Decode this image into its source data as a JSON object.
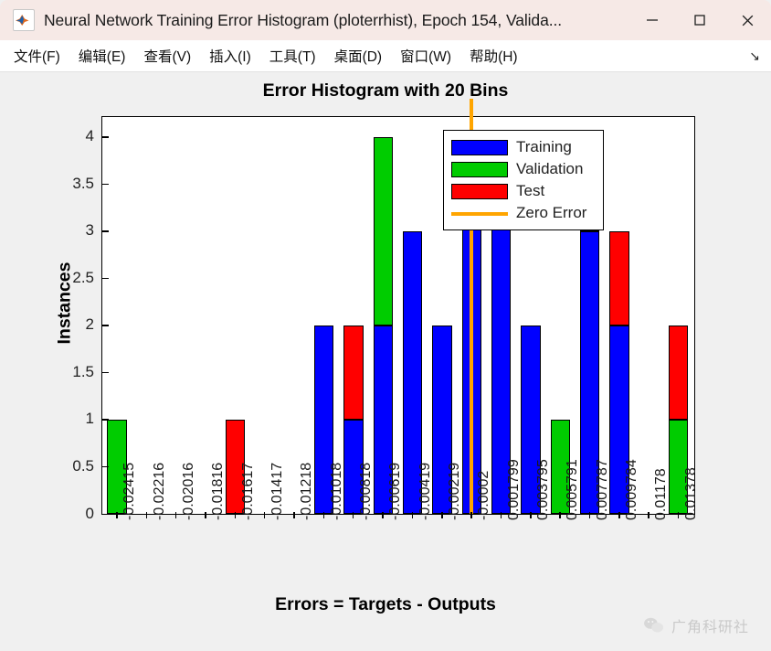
{
  "window": {
    "title": "Neural Network Training Error Histogram (ploterrhist), Epoch 154, Valida...",
    "app_icon": "matlab-icon",
    "minimize_label": "─",
    "maximize_label": "□",
    "close_label": "✕"
  },
  "menubar": {
    "items": [
      {
        "label": "文件(F)",
        "name": "menu-file"
      },
      {
        "label": "编辑(E)",
        "name": "menu-edit"
      },
      {
        "label": "查看(V)",
        "name": "menu-view"
      },
      {
        "label": "插入(I)",
        "name": "menu-insert"
      },
      {
        "label": "工具(T)",
        "name": "menu-tools"
      },
      {
        "label": "桌面(D)",
        "name": "menu-desktop"
      },
      {
        "label": "窗口(W)",
        "name": "menu-window"
      },
      {
        "label": "帮助(H)",
        "name": "menu-help"
      }
    ],
    "expand_arrow": "↘"
  },
  "watermark": {
    "text": "广角科研社",
    "icon": "wechat-icon"
  },
  "chart_data": {
    "type": "bar",
    "title": "Error Histogram with 20 Bins",
    "xlabel": "Errors = Targets - Outputs",
    "ylabel": "Instances",
    "stacked": true,
    "grid": false,
    "legend_position": "top-right",
    "ylim": [
      0,
      4.2
    ],
    "yticks": [
      0,
      0.5,
      1,
      1.5,
      2,
      2.5,
      3,
      3.5,
      4
    ],
    "ytick_labels": [
      "0",
      "0.5",
      "1",
      "1.5",
      "2",
      "2.5",
      "3",
      "3.5",
      "4"
    ],
    "categories": [
      "-0.02415",
      "-0.02216",
      "-0.02016",
      "-0.01816",
      "-0.01617",
      "-0.01417",
      "-0.01218",
      "-0.01018",
      "-0.00818",
      "-0.00619",
      "-0.00419",
      "-0.00219",
      "-0.0002",
      "0.001799",
      "0.003795",
      "0.005791",
      "0.007787",
      "0.009784",
      "0.01178",
      "0.01378"
    ],
    "series": [
      {
        "name": "Training",
        "color": "#0000ff",
        "values": [
          0,
          0,
          0,
          0,
          0,
          0,
          0,
          2,
          1,
          2,
          3,
          2,
          4,
          4,
          2,
          0,
          3,
          2,
          0,
          0
        ]
      },
      {
        "name": "Validation",
        "color": "#00cc00",
        "values": [
          1,
          0,
          0,
          0,
          0,
          0,
          0,
          0,
          0,
          2,
          0,
          0,
          0,
          0,
          0,
          1,
          0,
          0,
          0,
          1
        ]
      },
      {
        "name": "Test",
        "color": "#ff0000",
        "values": [
          0,
          0,
          0,
          0,
          1,
          0,
          0,
          0,
          1,
          0,
          0,
          0,
          0,
          0,
          0,
          0,
          0.25,
          1,
          0,
          1
        ]
      }
    ],
    "totals": [
      1,
      0,
      0,
      0,
      1,
      0,
      0,
      2,
      2,
      4,
      3,
      2,
      4,
      4,
      2,
      1,
      3.25,
      3,
      0,
      2
    ],
    "zero_error": {
      "label": "Zero Error",
      "color": "#ffa500",
      "x_index": 12.5
    }
  },
  "legend": {
    "entries": [
      {
        "label": "Training",
        "color": "#0000ff",
        "marker": "patch"
      },
      {
        "label": "Validation",
        "color": "#00cc00",
        "marker": "patch"
      },
      {
        "label": "Test",
        "color": "#ff0000",
        "marker": "patch"
      },
      {
        "label": "Zero Error",
        "color": "#ffa500",
        "marker": "line"
      }
    ]
  }
}
